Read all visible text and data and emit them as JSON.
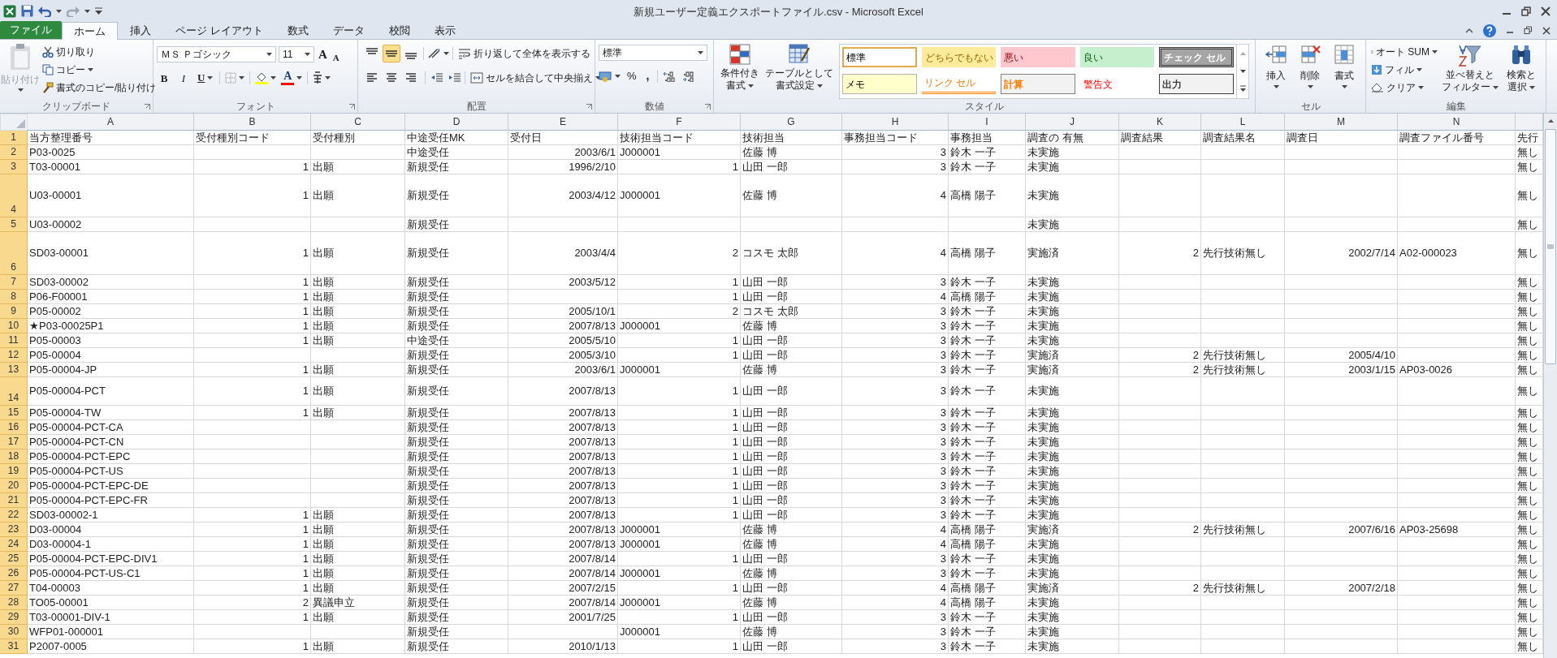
{
  "window": {
    "title": "新規ユーザー定義エクスポートファイル.csv - Microsoft Excel"
  },
  "tabs": [
    {
      "label": "ファイル",
      "kind": "file",
      "selected": false
    },
    {
      "label": "ホーム",
      "kind": "tab",
      "selected": true
    },
    {
      "label": "挿入",
      "kind": "tab",
      "selected": false
    },
    {
      "label": "ページ レイアウト",
      "kind": "tab",
      "selected": false
    },
    {
      "label": "数式",
      "kind": "tab",
      "selected": false
    },
    {
      "label": "データ",
      "kind": "tab",
      "selected": false
    },
    {
      "label": "校閲",
      "kind": "tab",
      "selected": false
    },
    {
      "label": "表示",
      "kind": "tab",
      "selected": false
    }
  ],
  "ribbon": {
    "clipboard": {
      "paste": {
        "label": "貼り付け",
        "disabled": true
      },
      "cut": "切り取り",
      "copy": "コピー",
      "format_painter": "書式のコピー/貼り付け",
      "label": "クリップボード"
    },
    "font": {
      "name": "ＭＳ Ｐゴシック",
      "size": "11",
      "grow": "A",
      "shrink": "A",
      "bold": "B",
      "italic": "I",
      "underline": "U",
      "font_color": "A",
      "label": "フォント"
    },
    "alignment": {
      "vertical": [
        {
          "kind": "top",
          "selected": false
        },
        {
          "kind": "middle",
          "selected": true
        },
        {
          "kind": "bottom",
          "selected": false
        }
      ],
      "wrap_text": "折り返して全体を表示する",
      "merge": "セルを結合して中央揃え",
      "label": "配置"
    },
    "number": {
      "format": "標準",
      "percent": "%",
      "comma": ",",
      "label": "数値"
    },
    "styles": {
      "conditional": [
        "条件付き",
        "書式"
      ],
      "table": [
        "テーブルとして",
        "書式設定"
      ],
      "label": "スタイル",
      "cells": [
        {
          "label": "標準",
          "kind": "normal"
        },
        {
          "label": "どちらでもない",
          "kind": "neutral"
        },
        {
          "label": "悪い",
          "kind": "bad"
        },
        {
          "label": "良い",
          "kind": "good"
        },
        {
          "label": "チェック セル",
          "kind": "check"
        },
        {
          "label": "メモ",
          "kind": "note"
        },
        {
          "label": "リンク セル",
          "kind": "link"
        },
        {
          "label": "計算",
          "kind": "calc"
        },
        {
          "label": "警告文",
          "kind": "warning"
        },
        {
          "label": "出力",
          "kind": "output"
        }
      ]
    },
    "cells": {
      "buttons": [
        {
          "label": "挿入",
          "kind": "insert"
        },
        {
          "label": "削除",
          "kind": "delete"
        },
        {
          "label": "書式",
          "kind": "format"
        }
      ],
      "label": "セル"
    },
    "editing": {
      "autosum": "オート SUM",
      "fill": "フィル",
      "clear": "クリア",
      "sort": [
        "並べ替えと",
        "フィルター"
      ],
      "find": [
        "検索と",
        "選択"
      ],
      "label": "編集"
    }
  },
  "sheet": {
    "columns": [
      "A",
      "B",
      "C",
      "D",
      "E",
      "F",
      "G",
      "H",
      "I",
      "J",
      "K",
      "L",
      "M",
      "N"
    ],
    "rows": [
      {
        "number": "1",
        "cells": {
          "A": "当方整理番号",
          "B": "受付種別コード",
          "C": "受付種別",
          "D": "中途受任MK",
          "E": "受付日",
          "F": "技術担当コード",
          "G": "技術担当",
          "H": "事務担当コード",
          "I": "事務担当",
          "J": "調査の 有無",
          "K": "調査結果",
          "L": "調査結果名",
          "M": "調査日",
          "N": "調査ファイル番号",
          "O": "先行"
        }
      },
      {
        "number": "2",
        "cells": {
          "A": "P03-0025",
          "D": "中途受任",
          "E": "2003/6/1",
          "F": "J000001",
          "G": "佐藤 博",
          "H": "3",
          "I": "鈴木 一子",
          "J": "未実施",
          "O": "無し"
        }
      },
      {
        "number": "3",
        "cells": {
          "A": "T03-00001",
          "B": "1",
          "C": "出願",
          "D": "新規受任",
          "E": "1996/2/10",
          "F": "1",
          "G": "山田 一郎",
          "H": "3",
          "I": "鈴木 一子",
          "J": "未実施",
          "O": "無し"
        }
      },
      {
        "number": "4",
        "cells": {
          "A": "U03-00001",
          "B": "1",
          "C": "出願",
          "D": "新規受任",
          "E": "2003/4/12",
          "F": "J000001",
          "G": "佐藤 博",
          "H": "4",
          "I": "高橋 陽子",
          "J": "未実施",
          "O": "無し"
        }
      },
      {
        "number": "5",
        "cells": {
          "A": "U03-00002",
          "D": "新規受任",
          "J": "未実施",
          "O": "無し"
        }
      },
      {
        "number": "6",
        "cells": {
          "A": "SD03-00001",
          "B": "1",
          "C": "出願",
          "D": "新規受任",
          "E": "2003/4/4",
          "F": "2",
          "G": "コスモ 太郎",
          "H": "4",
          "I": "高橋 陽子",
          "J": "実施済",
          "K": "2",
          "L": "先行技術無し",
          "M": "2002/7/14",
          "N": "A02-000023",
          "O": "無し"
        }
      },
      {
        "number": "7",
        "cells": {
          "A": "SD03-00002",
          "B": "1",
          "C": "出願",
          "D": "新規受任",
          "E": "2003/5/12",
          "F": "1",
          "G": "山田 一郎",
          "H": "3",
          "I": "鈴木 一子",
          "J": "未実施",
          "O": "無し"
        }
      },
      {
        "number": "8",
        "cells": {
          "A": "P06-F00001",
          "B": "1",
          "C": "出願",
          "D": "新規受任",
          "F": "1",
          "G": "山田 一郎",
          "H": "4",
          "I": "高橋 陽子",
          "J": "未実施",
          "O": "無し"
        }
      },
      {
        "number": "9",
        "cells": {
          "A": "P05-00002",
          "B": "1",
          "C": "出願",
          "D": "新規受任",
          "E": "2005/10/1",
          "F": "2",
          "G": "コスモ 太郎",
          "H": "3",
          "I": "鈴木 一子",
          "J": "未実施",
          "O": "無し"
        }
      },
      {
        "number": "10",
        "cells": {
          "A": "★P03-00025P1",
          "B": "1",
          "C": "出願",
          "D": "新規受任",
          "E": "2007/8/13",
          "F": "J000001",
          "G": "佐藤 博",
          "H": "3",
          "I": "鈴木 一子",
          "J": "未実施",
          "O": "無し"
        }
      },
      {
        "number": "11",
        "cells": {
          "A": "P05-00003",
          "B": "1",
          "C": "出願",
          "D": "中途受任",
          "E": "2005/5/10",
          "F": "1",
          "G": "山田 一郎",
          "H": "3",
          "I": "鈴木 一子",
          "J": "未実施",
          "O": "無し"
        }
      },
      {
        "number": "12",
        "cells": {
          "A": "P05-00004",
          "D": "新規受任",
          "E": "2005/3/10",
          "F": "1",
          "G": "山田 一郎",
          "H": "3",
          "I": "鈴木 一子",
          "J": "実施済",
          "K": "2",
          "L": "先行技術無し",
          "M": "2005/4/10",
          "O": "無し"
        }
      },
      {
        "number": "13",
        "cells": {
          "A": "P05-00004-JP",
          "B": "1",
          "C": "出願",
          "D": "新規受任",
          "E": "2003/6/1",
          "F": "J000001",
          "G": "佐藤 博",
          "H": "3",
          "I": "鈴木 一子",
          "J": "実施済",
          "K": "2",
          "L": "先行技術無し",
          "M": "2003/1/15",
          "N": "AP03-0026",
          "O": "無し"
        }
      },
      {
        "number": "14",
        "cells": {
          "A": "P05-00004-PCT",
          "B": "1",
          "C": "出願",
          "D": "新規受任",
          "E": "2007/8/13",
          "F": "1",
          "G": "山田 一郎",
          "H": "3",
          "I": "鈴木 一子",
          "J": "未実施",
          "O": "無し"
        }
      },
      {
        "number": "15",
        "cells": {
          "A": "P05-00004-TW",
          "B": "1",
          "C": "出願",
          "D": "新規受任",
          "E": "2007/8/13",
          "F": "1",
          "G": "山田 一郎",
          "H": "3",
          "I": "鈴木 一子",
          "J": "未実施",
          "O": "無し"
        }
      },
      {
        "number": "16",
        "cells": {
          "A": "P05-00004-PCT-CA",
          "D": "新規受任",
          "E": "2007/8/13",
          "F": "1",
          "G": "山田 一郎",
          "H": "3",
          "I": "鈴木 一子",
          "J": "未実施",
          "O": "無し"
        }
      },
      {
        "number": "17",
        "cells": {
          "A": "P05-00004-PCT-CN",
          "D": "新規受任",
          "E": "2007/8/13",
          "F": "1",
          "G": "山田 一郎",
          "H": "3",
          "I": "鈴木 一子",
          "J": "未実施",
          "O": "無し"
        }
      },
      {
        "number": "18",
        "cells": {
          "A": "P05-00004-PCT-EPC",
          "D": "新規受任",
          "E": "2007/8/13",
          "F": "1",
          "G": "山田 一郎",
          "H": "3",
          "I": "鈴木 一子",
          "J": "未実施",
          "O": "無し"
        }
      },
      {
        "number": "19",
        "cells": {
          "A": "P05-00004-PCT-US",
          "D": "新規受任",
          "E": "2007/8/13",
          "F": "1",
          "G": "山田 一郎",
          "H": "3",
          "I": "鈴木 一子",
          "J": "未実施",
          "O": "無し"
        }
      },
      {
        "number": "20",
        "cells": {
          "A": "P05-00004-PCT-EPC-DE",
          "D": "新規受任",
          "E": "2007/8/13",
          "F": "1",
          "G": "山田 一郎",
          "H": "3",
          "I": "鈴木 一子",
          "J": "未実施",
          "O": "無し"
        }
      },
      {
        "number": "21",
        "cells": {
          "A": "P05-00004-PCT-EPC-FR",
          "D": "新規受任",
          "E": "2007/8/13",
          "F": "1",
          "G": "山田 一郎",
          "H": "3",
          "I": "鈴木 一子",
          "J": "未実施",
          "O": "無し"
        }
      },
      {
        "number": "22",
        "cells": {
          "A": "SD03-00002-1",
          "B": "1",
          "C": "出願",
          "D": "新規受任",
          "E": "2007/8/13",
          "F": "1",
          "G": "山田 一郎",
          "H": "3",
          "I": "鈴木 一子",
          "J": "未実施",
          "O": "無し"
        }
      },
      {
        "number": "23",
        "cells": {
          "A": "D03-00004",
          "B": "1",
          "C": "出願",
          "D": "新規受任",
          "E": "2007/8/13",
          "F": "J000001",
          "G": "佐藤 博",
          "H": "4",
          "I": "高橋 陽子",
          "J": "実施済",
          "K": "2",
          "L": "先行技術無し",
          "M": "2007/6/16",
          "N": "AP03-25698",
          "O": "無し"
        }
      },
      {
        "number": "24",
        "cells": {
          "A": "D03-00004-1",
          "B": "1",
          "C": "出願",
          "D": "新規受任",
          "E": "2007/8/13",
          "F": "J000001",
          "G": "佐藤 博",
          "H": "4",
          "I": "高橋 陽子",
          "J": "未実施",
          "O": "無し"
        }
      },
      {
        "number": "25",
        "cells": {
          "A": "P05-00004-PCT-EPC-DIV1",
          "B": "1",
          "C": "出願",
          "D": "新規受任",
          "E": "2007/8/14",
          "F": "1",
          "G": "山田 一郎",
          "H": "3",
          "I": "鈴木 一子",
          "J": "未実施",
          "O": "無し"
        }
      },
      {
        "number": "26",
        "cells": {
          "A": "P05-00004-PCT-US-C1",
          "B": "1",
          "C": "出願",
          "D": "新規受任",
          "E": "2007/8/14",
          "F": "J000001",
          "G": "佐藤 博",
          "H": "3",
          "I": "鈴木 一子",
          "J": "未実施",
          "O": "無し"
        }
      },
      {
        "number": "27",
        "cells": {
          "A": "T04-00003",
          "B": "1",
          "C": "出願",
          "D": "新規受任",
          "E": "2007/2/15",
          "F": "1",
          "G": "山田 一郎",
          "H": "4",
          "I": "高橋 陽子",
          "J": "実施済",
          "K": "2",
          "L": "先行技術無し",
          "M": "2007/2/18",
          "O": "無し"
        }
      },
      {
        "number": "28",
        "cells": {
          "A": "TO05-00001",
          "B": "2",
          "C": "異議申立",
          "D": "新規受任",
          "E": "2007/8/14",
          "F": "J000001",
          "G": "佐藤 博",
          "H": "4",
          "I": "高橋 陽子",
          "J": "未実施",
          "O": "無し"
        }
      },
      {
        "number": "29",
        "cells": {
          "A": "T03-00001-DIV-1",
          "B": "1",
          "C": "出願",
          "D": "新規受任",
          "E": "2001/7/25",
          "F": "1",
          "G": "山田 一郎",
          "H": "3",
          "I": "鈴木 一子",
          "J": "未実施",
          "O": "無し"
        }
      },
      {
        "number": "30",
        "cells": {
          "A": "WFP01-000001",
          "D": "新規受任",
          "F": "J000001",
          "G": "佐藤 博",
          "H": "3",
          "I": "鈴木 一子",
          "J": "未実施",
          "O": "無し"
        }
      },
      {
        "number": "31",
        "cells": {
          "A": "P2007-0005",
          "B": "1",
          "C": "出願",
          "D": "新規受任",
          "E": "2010/1/13",
          "F": "1",
          "G": "山田 一郎",
          "H": "3",
          "I": "鈴木 一子",
          "J": "未実施",
          "O": "無し"
        }
      }
    ]
  }
}
